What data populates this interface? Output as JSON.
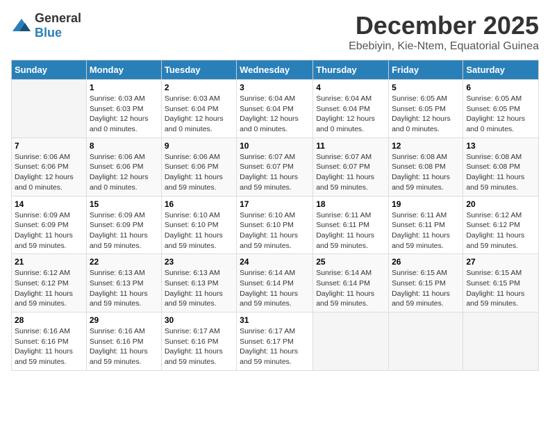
{
  "logo": {
    "text_general": "General",
    "text_blue": "Blue"
  },
  "header": {
    "month_year": "December 2025",
    "location": "Ebebiyin, Kie-Ntem, Equatorial Guinea"
  },
  "weekdays": [
    "Sunday",
    "Monday",
    "Tuesday",
    "Wednesday",
    "Thursday",
    "Friday",
    "Saturday"
  ],
  "weeks": [
    [
      {
        "day": "",
        "sunrise": "",
        "sunset": "",
        "daylight": ""
      },
      {
        "day": "1",
        "sunrise": "Sunrise: 6:03 AM",
        "sunset": "Sunset: 6:03 PM",
        "daylight": "Daylight: 12 hours and 0 minutes."
      },
      {
        "day": "2",
        "sunrise": "Sunrise: 6:03 AM",
        "sunset": "Sunset: 6:04 PM",
        "daylight": "Daylight: 12 hours and 0 minutes."
      },
      {
        "day": "3",
        "sunrise": "Sunrise: 6:04 AM",
        "sunset": "Sunset: 6:04 PM",
        "daylight": "Daylight: 12 hours and 0 minutes."
      },
      {
        "day": "4",
        "sunrise": "Sunrise: 6:04 AM",
        "sunset": "Sunset: 6:04 PM",
        "daylight": "Daylight: 12 hours and 0 minutes."
      },
      {
        "day": "5",
        "sunrise": "Sunrise: 6:05 AM",
        "sunset": "Sunset: 6:05 PM",
        "daylight": "Daylight: 12 hours and 0 minutes."
      },
      {
        "day": "6",
        "sunrise": "Sunrise: 6:05 AM",
        "sunset": "Sunset: 6:05 PM",
        "daylight": "Daylight: 12 hours and 0 minutes."
      }
    ],
    [
      {
        "day": "7",
        "sunrise": "Sunrise: 6:06 AM",
        "sunset": "Sunset: 6:06 PM",
        "daylight": "Daylight: 12 hours and 0 minutes."
      },
      {
        "day": "8",
        "sunrise": "Sunrise: 6:06 AM",
        "sunset": "Sunset: 6:06 PM",
        "daylight": "Daylight: 12 hours and 0 minutes."
      },
      {
        "day": "9",
        "sunrise": "Sunrise: 6:06 AM",
        "sunset": "Sunset: 6:06 PM",
        "daylight": "Daylight: 11 hours and 59 minutes."
      },
      {
        "day": "10",
        "sunrise": "Sunrise: 6:07 AM",
        "sunset": "Sunset: 6:07 PM",
        "daylight": "Daylight: 11 hours and 59 minutes."
      },
      {
        "day": "11",
        "sunrise": "Sunrise: 6:07 AM",
        "sunset": "Sunset: 6:07 PM",
        "daylight": "Daylight: 11 hours and 59 minutes."
      },
      {
        "day": "12",
        "sunrise": "Sunrise: 6:08 AM",
        "sunset": "Sunset: 6:08 PM",
        "daylight": "Daylight: 11 hours and 59 minutes."
      },
      {
        "day": "13",
        "sunrise": "Sunrise: 6:08 AM",
        "sunset": "Sunset: 6:08 PM",
        "daylight": "Daylight: 11 hours and 59 minutes."
      }
    ],
    [
      {
        "day": "14",
        "sunrise": "Sunrise: 6:09 AM",
        "sunset": "Sunset: 6:09 PM",
        "daylight": "Daylight: 11 hours and 59 minutes."
      },
      {
        "day": "15",
        "sunrise": "Sunrise: 6:09 AM",
        "sunset": "Sunset: 6:09 PM",
        "daylight": "Daylight: 11 hours and 59 minutes."
      },
      {
        "day": "16",
        "sunrise": "Sunrise: 6:10 AM",
        "sunset": "Sunset: 6:10 PM",
        "daylight": "Daylight: 11 hours and 59 minutes."
      },
      {
        "day": "17",
        "sunrise": "Sunrise: 6:10 AM",
        "sunset": "Sunset: 6:10 PM",
        "daylight": "Daylight: 11 hours and 59 minutes."
      },
      {
        "day": "18",
        "sunrise": "Sunrise: 6:11 AM",
        "sunset": "Sunset: 6:11 PM",
        "daylight": "Daylight: 11 hours and 59 minutes."
      },
      {
        "day": "19",
        "sunrise": "Sunrise: 6:11 AM",
        "sunset": "Sunset: 6:11 PM",
        "daylight": "Daylight: 11 hours and 59 minutes."
      },
      {
        "day": "20",
        "sunrise": "Sunrise: 6:12 AM",
        "sunset": "Sunset: 6:12 PM",
        "daylight": "Daylight: 11 hours and 59 minutes."
      }
    ],
    [
      {
        "day": "21",
        "sunrise": "Sunrise: 6:12 AM",
        "sunset": "Sunset: 6:12 PM",
        "daylight": "Daylight: 11 hours and 59 minutes."
      },
      {
        "day": "22",
        "sunrise": "Sunrise: 6:13 AM",
        "sunset": "Sunset: 6:13 PM",
        "daylight": "Daylight: 11 hours and 59 minutes."
      },
      {
        "day": "23",
        "sunrise": "Sunrise: 6:13 AM",
        "sunset": "Sunset: 6:13 PM",
        "daylight": "Daylight: 11 hours and 59 minutes."
      },
      {
        "day": "24",
        "sunrise": "Sunrise: 6:14 AM",
        "sunset": "Sunset: 6:14 PM",
        "daylight": "Daylight: 11 hours and 59 minutes."
      },
      {
        "day": "25",
        "sunrise": "Sunrise: 6:14 AM",
        "sunset": "Sunset: 6:14 PM",
        "daylight": "Daylight: 11 hours and 59 minutes."
      },
      {
        "day": "26",
        "sunrise": "Sunrise: 6:15 AM",
        "sunset": "Sunset: 6:15 PM",
        "daylight": "Daylight: 11 hours and 59 minutes."
      },
      {
        "day": "27",
        "sunrise": "Sunrise: 6:15 AM",
        "sunset": "Sunset: 6:15 PM",
        "daylight": "Daylight: 11 hours and 59 minutes."
      }
    ],
    [
      {
        "day": "28",
        "sunrise": "Sunrise: 6:16 AM",
        "sunset": "Sunset: 6:16 PM",
        "daylight": "Daylight: 11 hours and 59 minutes."
      },
      {
        "day": "29",
        "sunrise": "Sunrise: 6:16 AM",
        "sunset": "Sunset: 6:16 PM",
        "daylight": "Daylight: 11 hours and 59 minutes."
      },
      {
        "day": "30",
        "sunrise": "Sunrise: 6:17 AM",
        "sunset": "Sunset: 6:16 PM",
        "daylight": "Daylight: 11 hours and 59 minutes."
      },
      {
        "day": "31",
        "sunrise": "Sunrise: 6:17 AM",
        "sunset": "Sunset: 6:17 PM",
        "daylight": "Daylight: 11 hours and 59 minutes."
      },
      {
        "day": "",
        "sunrise": "",
        "sunset": "",
        "daylight": ""
      },
      {
        "day": "",
        "sunrise": "",
        "sunset": "",
        "daylight": ""
      },
      {
        "day": "",
        "sunrise": "",
        "sunset": "",
        "daylight": ""
      }
    ]
  ]
}
